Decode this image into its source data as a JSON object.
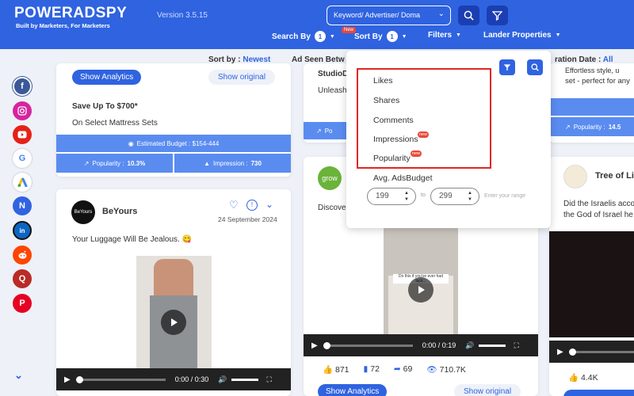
{
  "header": {
    "logo": "POWERADSPY",
    "tagline": "Built by Marketers, For Marketers",
    "version": "Version 3.5.15",
    "search_placeholder": "Keyword/ Advertiser/ Doma",
    "menu": {
      "search_by": "Search By",
      "search_by_count": "1",
      "sort_by": "Sort By",
      "sort_by_count": "1",
      "sort_new_tag": "New",
      "filters": "Filters",
      "lander": "Lander Properties"
    }
  },
  "sortrow": {
    "sort_label": "Sort by :",
    "sort_value": "Newest",
    "ad_seen": "Ad Seen Betw",
    "duration_label": "ration Date :",
    "duration_value": "All"
  },
  "social_icons": [
    "facebook-icon",
    "instagram-icon",
    "youtube-icon",
    "google-icon",
    "google-ads-icon",
    "native-icon",
    "linkedin-icon",
    "reddit-icon",
    "quora-icon",
    "pinterest-icon"
  ],
  "card1": {
    "show_analytics": "Show Analytics",
    "show_original": "Show original",
    "title": "Save Up To $700*",
    "subtitle": "On Select Mattress Sets",
    "budget": "Estimated Budget : $154-444",
    "popularity_label": "Popularity :",
    "popularity_value": "10.3%",
    "impression_label": "Impression :",
    "impression_value": "730"
  },
  "card2": {
    "advertiser": "BeYours",
    "date": "24 September 2024",
    "text": "Your Luggage Will Be Jealous. 😋",
    "time": "0:00 / 0:30"
  },
  "card3": {
    "advertiser_top": "StudioD",
    "text_top": "Unleash",
    "popularity_top": "Po",
    "avatar_text": "grow",
    "text": "Discove",
    "video_overlay": "Do this if you've ever had luck...",
    "time": "0:00 / 0:19",
    "likes": "871",
    "comments": "72",
    "shares": "69",
    "views": "710.7K",
    "show_analytics": "Show Analytics",
    "show_original": "Show original"
  },
  "card4": {
    "text_top1": "Effortless style, u",
    "text_top2": "set - perfect for any",
    "popularity_label": "Popularity :",
    "popularity_value": "14.5",
    "advertiser": "Tree of Li",
    "text1": "Did the Israelis acco",
    "text2": "the God of Israel he",
    "likes": "4.4K"
  },
  "dropdown": {
    "items": [
      "Likes",
      "Shares",
      "Comments",
      "Impressions",
      "Popularity"
    ],
    "new_tag": "new",
    "avg_label": "Avg. AdsBudget",
    "min_value": "199",
    "to": "to",
    "max_value": "299",
    "hint": "Enter your range"
  },
  "colors": {
    "brand_blue": "#2f63e0",
    "highlight_red": "#e02626"
  }
}
